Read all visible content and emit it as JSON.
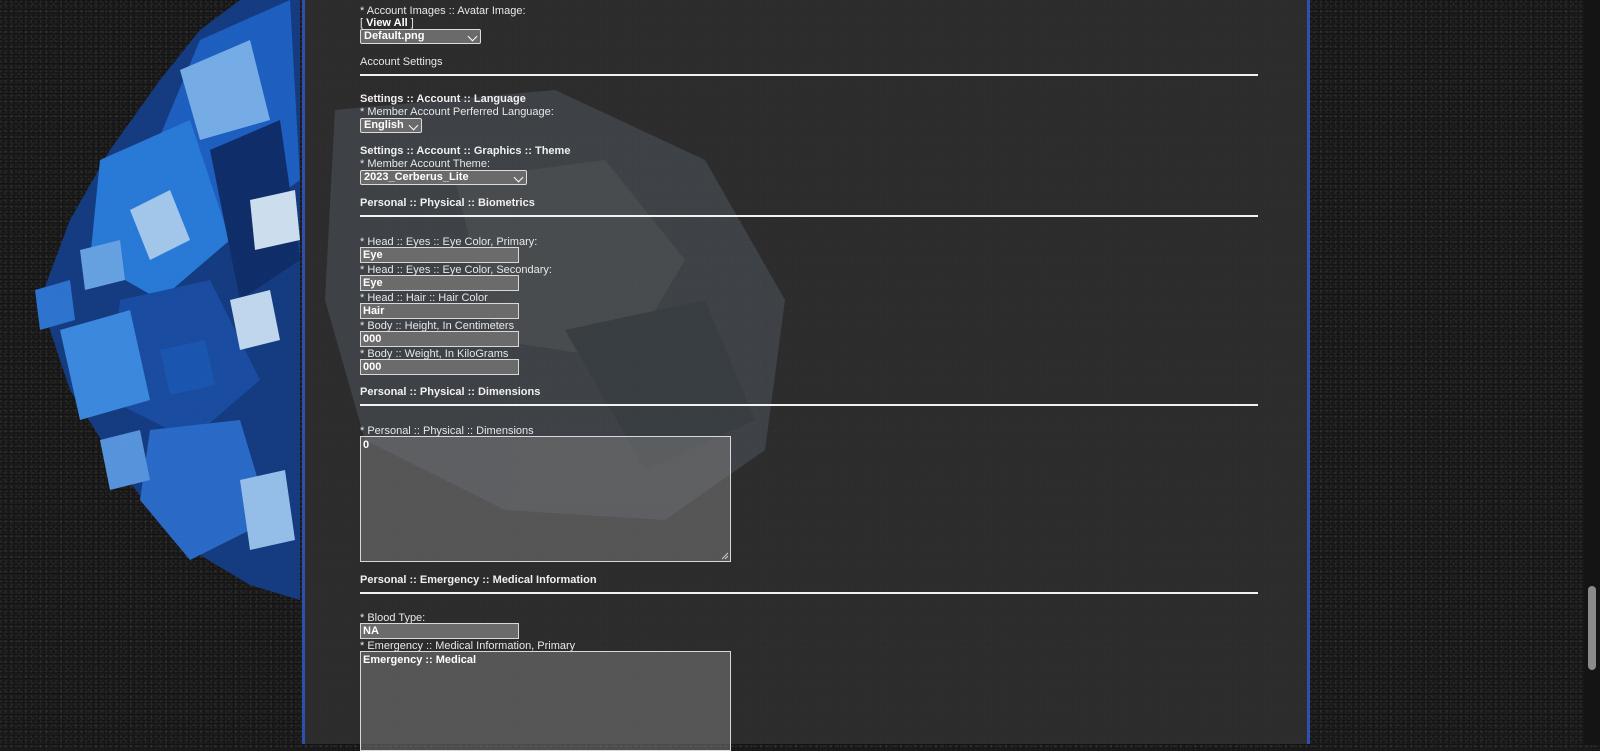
{
  "avatar": {
    "label": "* Account Images :: Avatar Image:",
    "bracket_open": "[",
    "view_all": "View All",
    "bracket_close": "]",
    "selected": "Default.png"
  },
  "account_settings": {
    "title": "Account Settings"
  },
  "language": {
    "heading": "Settings :: Account :: Language",
    "label": "* Member Account Perferred Language:",
    "selected": "English"
  },
  "theme": {
    "heading": "Settings :: Account :: Graphics :: Theme",
    "label": "* Member Account Theme:",
    "selected": "2023_Cerberus_Lite"
  },
  "biometrics": {
    "heading": "Personal :: Physical :: Biometrics",
    "fields": [
      {
        "label": "* Head :: Eyes :: Eye Color, Primary:",
        "value": "Eye"
      },
      {
        "label": "* Head :: Eyes :: Eye Color, Secondary:",
        "value": "Eye"
      },
      {
        "label": "* Head :: Hair :: Hair Color",
        "value": "Hair"
      },
      {
        "label": "* Body :: Height, In Centimeters",
        "value": "000"
      },
      {
        "label": "* Body :: Weight, In KiloGrams",
        "value": "000"
      }
    ]
  },
  "dimensions": {
    "heading": "Personal :: Physical :: Dimensions",
    "label": "* Personal :: Physical :: Dimensions",
    "value": "0"
  },
  "medical": {
    "heading": "Personal :: Emergency :: Medical Information",
    "blood_label": "* Blood Type:",
    "blood_value": "NA",
    "primary_label": "* Emergency :: Medical Information, Primary",
    "primary_value": "Emergency :: Medical"
  },
  "colors": {
    "panel_border": "#2f4fb0",
    "panel_bg": "#2e2e2e",
    "art_blue": "#1e63c8",
    "text": "#e8e8e8"
  }
}
